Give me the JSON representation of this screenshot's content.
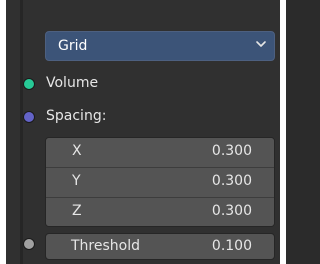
{
  "dropdown": {
    "label": "Grid"
  },
  "inputs": {
    "volume": {
      "label": "Volume",
      "socket_color": "#27c996"
    },
    "spacing": {
      "label": "Spacing:",
      "socket_color": "#6363c7",
      "fields": [
        {
          "axis": "X",
          "value": "0.300"
        },
        {
          "axis": "Y",
          "value": "0.300"
        },
        {
          "axis": "Z",
          "value": "0.300"
        }
      ]
    },
    "threshold": {
      "label": "Threshold",
      "value": "0.100",
      "socket_color": "#a0a0a0"
    }
  },
  "colors": {
    "dropdown_bg": "#3c5478",
    "field_bg": "#545454",
    "panel_bg": "#303030"
  }
}
